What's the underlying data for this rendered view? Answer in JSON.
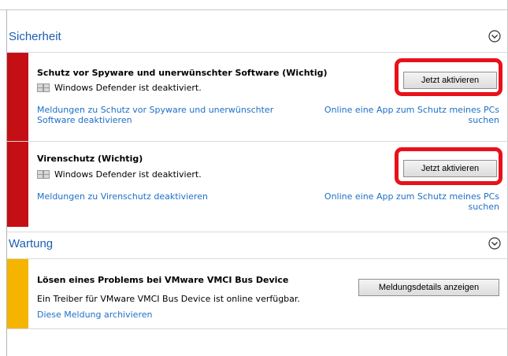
{
  "colors": {
    "accent": "#1e5fae",
    "link": "#1e6fc7",
    "critical_stripe": "#c40f15",
    "warning_stripe": "#f4b400",
    "highlight": "#e8111b"
  },
  "security": {
    "title": "Sicherheit",
    "spyware": {
      "title": "Schutz vor Spyware und unerwünschter Software  (Wichtig)",
      "status": "Windows Defender ist deaktiviert.",
      "button": "Jetzt aktivieren",
      "link_left": "Meldungen zu Schutz vor Spyware und unerwünschter Software deaktivieren",
      "link_right": "Online eine App zum Schutz meines PCs suchen"
    },
    "virus": {
      "title": "Virenschutz  (Wichtig)",
      "status": "Windows Defender ist deaktiviert.",
      "button": "Jetzt aktivieren",
      "link_left": "Meldungen zu Virenschutz deaktivieren",
      "link_right": "Online eine App zum Schutz meines PCs suchen"
    }
  },
  "maintenance": {
    "title": "Wartung",
    "vmware": {
      "title": "Lösen eines Problems bei VMware VMCI Bus Device",
      "description": "Ein Treiber für VMware VMCI Bus Device ist online verfügbar.",
      "button": "Meldungsdetails anzeigen",
      "link_left": "Diese Meldung archivieren"
    }
  }
}
